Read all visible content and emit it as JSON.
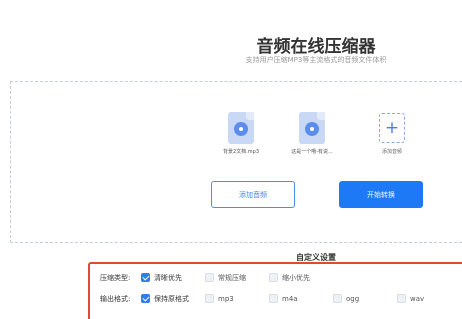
{
  "header": {
    "title": "音频在线压缩器",
    "subtitle": "支持用户压缩MP3等主流格式的音频文件体积"
  },
  "files": [
    {
      "name": "背景2文档.mp3",
      "icon": "audio-file-icon"
    },
    {
      "name": "这是一个哦-有说...",
      "icon": "audio-file-icon"
    }
  ],
  "add_tile": {
    "label": "添加音频",
    "icon": "plus-icon"
  },
  "buttons": {
    "add_audio": "添加音频",
    "start": "开始转换"
  },
  "settings": {
    "title": "自定义设置",
    "compress_type": {
      "label": "压缩类型:",
      "options": [
        {
          "label": "清晰优先",
          "checked": true
        },
        {
          "label": "常规压缩",
          "checked": false
        },
        {
          "label": "缩小优先",
          "checked": false
        }
      ]
    },
    "output_format": {
      "label": "输出格式:",
      "options": [
        {
          "label": "保持原格式",
          "checked": true
        },
        {
          "label": "mp3",
          "checked": false
        },
        {
          "label": "m4a",
          "checked": false
        },
        {
          "label": "ogg",
          "checked": false
        },
        {
          "label": "wav",
          "checked": false
        }
      ]
    }
  },
  "colors": {
    "primary": "#1d79f5",
    "settings_border": "#e04a30"
  }
}
